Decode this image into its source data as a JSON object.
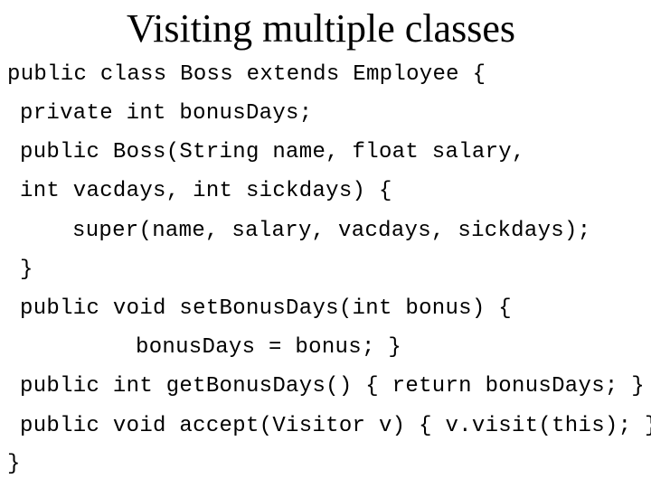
{
  "slide": {
    "title": "Visiting multiple classes",
    "code_lines": [
      "public class Boss extends Employee {",
      "private int bonusDays;",
      "public Boss(String name, float salary,",
      "int vacdays, int sickdays) {",
      "super(name, salary, vacdays, sickdays);",
      "}",
      "public void setBonusDays(int bonus) {",
      "bonusDays = bonus; }",
      "public int getBonusDays() { return bonusDays; }",
      "public void accept(Visitor v) { v.visit(this); }",
      "}"
    ]
  }
}
